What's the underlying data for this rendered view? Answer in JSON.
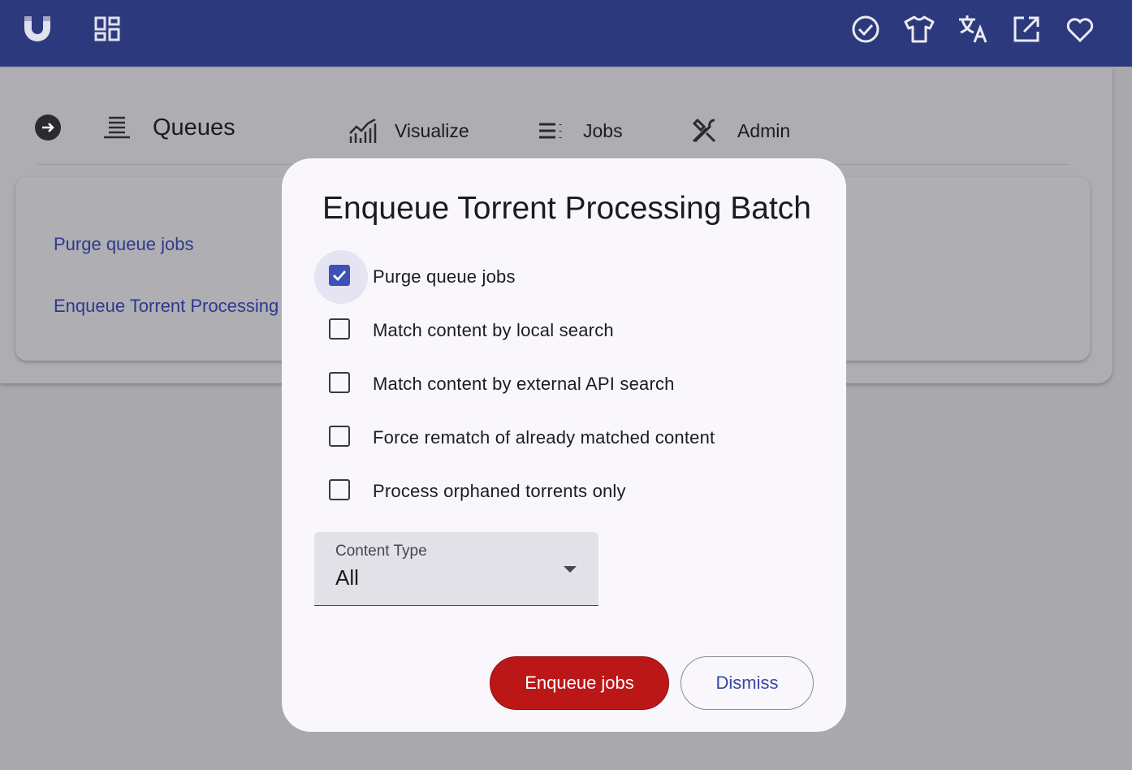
{
  "topbar": {
    "background": "#2c397d",
    "left_icons": [
      "magnet-icon",
      "dashboard-icon"
    ],
    "right_icons": [
      "check-circle-icon",
      "tshirt-icon",
      "translate-icon",
      "open-external-icon",
      "heart-icon"
    ]
  },
  "nav": {
    "current": "Queues",
    "items": [
      {
        "label": "Visualize",
        "icon": "chart-icon"
      },
      {
        "label": "Jobs",
        "icon": "list-icon"
      },
      {
        "label": "Admin",
        "icon": "tools-icon"
      }
    ]
  },
  "page": {
    "links": [
      "Purge queue jobs",
      "Enqueue Torrent Processing Batch"
    ]
  },
  "dialog": {
    "title": "Enqueue Torrent Processing Batch",
    "options": [
      {
        "label": "Purge queue jobs",
        "checked": true
      },
      {
        "label": "Match content by local search",
        "checked": false
      },
      {
        "label": "Match content by external API search",
        "checked": false
      },
      {
        "label": "Force rematch of already matched content",
        "checked": false
      },
      {
        "label": "Process orphaned torrents only",
        "checked": false
      }
    ],
    "content_type": {
      "label": "Content Type",
      "value": "All"
    },
    "primary_button": "Enqueue jobs",
    "secondary_button": "Dismiss",
    "accent": "#3f51b5",
    "danger": "#bc1717"
  }
}
